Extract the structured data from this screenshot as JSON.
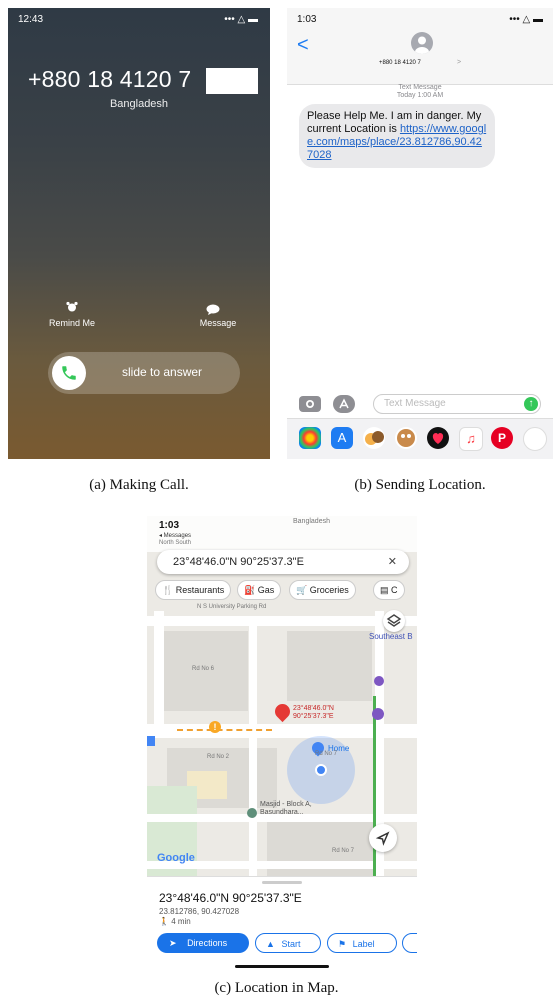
{
  "panel_a": {
    "status_time": "12:43",
    "status_icons": "••• △ ▬",
    "caller_number": "+880 18 4120 7",
    "caller_country": "Bangladesh",
    "remind_label": "Remind Me",
    "message_label": "Message",
    "slide_label": "slide to answer"
  },
  "panel_b": {
    "status_time": "1:03",
    "status_icons": "••• △ ▬",
    "back_glyph": "<",
    "contact_number": "+880 18 4120 7",
    "chevron": ">",
    "header_label": "Text Message",
    "header_time": "Today 1:00 AM",
    "message_text": "Please Help Me. I am in danger. My current Location is ",
    "message_link": "https://www.google.com/maps/place/23.812786,90.427028",
    "input_placeholder": "Text Message",
    "send_glyph": "↑"
  },
  "panel_c": {
    "status_time": "1:03",
    "status_back": "◂ Messages",
    "status_region": "Bangladesh",
    "top_fragment": "North South",
    "search_text": "23°48'46.0\"N 90°25'37.3\"E",
    "close_glyph": "✕",
    "chips": [
      "Restaurants",
      "Gas",
      "Groceries",
      "C"
    ],
    "pin_label_1": "23°48'46.0\"N",
    "pin_label_2": "90°25'37.3\"E",
    "home_label": "Home",
    "masjid_label": "Masjid - Block A, Basundhara...",
    "google_logo": "Google",
    "map_labels": [
      "N S University Parking Rd",
      "Rd No 6",
      "Rd No 2",
      "Rd No 7",
      "Rd No 7",
      "Southeast B",
      "NSU Main Campus Rd"
    ],
    "sheet_title": "23°48'46.0\"N 90°25'37.3\"E",
    "sheet_coords": "23.812786, 90.427028",
    "sheet_walk": "4 min",
    "btn_directions": "Directions",
    "btn_start": "Start",
    "btn_label": "Label"
  },
  "captions": {
    "a": "(a) Making Call.",
    "b": "(b) Sending Location.",
    "c": "(c) Location in Map."
  },
  "colors": {
    "green": "#34c759",
    "blue": "#1a73e8",
    "red_pin": "#e53935",
    "link": "#1e63c8"
  }
}
